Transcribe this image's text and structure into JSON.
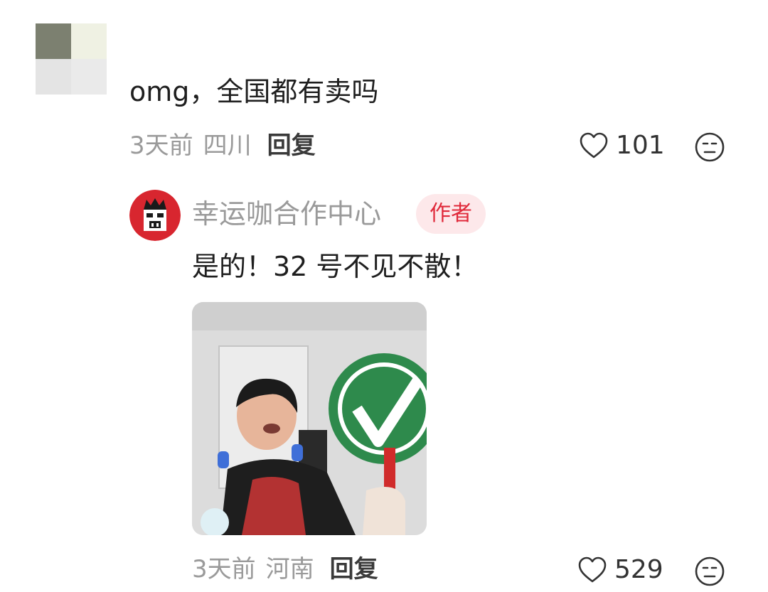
{
  "comments": [
    {
      "text": "omg，全国都有卖吗",
      "time": "3天前",
      "region": "四川",
      "reply_label": "回复",
      "likes": "101"
    }
  ],
  "reply": {
    "author_name": "幸运咖合作中心",
    "author_badge": "作者",
    "text": "是的！32 号不见不散！",
    "sticker_caption": "",
    "time": "3天前",
    "region": "河南",
    "reply_label": "回复",
    "likes": "529"
  },
  "icons": {
    "like": "heart-outline-icon",
    "dislike": "dislike-face-icon"
  },
  "colors": {
    "author_badge_text": "#e0293a",
    "author_badge_bg": "#fde8ea",
    "meta_text": "#9a9a9a"
  }
}
